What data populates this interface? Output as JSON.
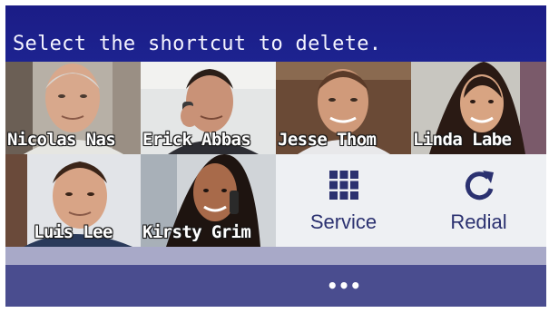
{
  "header": {
    "title": "Select the shortcut to delete."
  },
  "shortcuts": [
    {
      "name": "Nicolas Nas"
    },
    {
      "name": "Erick Abbas"
    },
    {
      "name": "Jesse Thom"
    },
    {
      "name": "Linda Labe"
    },
    {
      "name": "Luis Lee"
    },
    {
      "name": "Kirsty Grim"
    }
  ],
  "functions": [
    {
      "label": "Service",
      "icon": "grid-icon"
    },
    {
      "label": "Redial",
      "icon": "redial-icon"
    }
  ],
  "footer": {
    "more_label": "•••"
  },
  "colors": {
    "header": "#1d2390",
    "footer": "#4a4d8f",
    "icon": "#2b3170"
  }
}
